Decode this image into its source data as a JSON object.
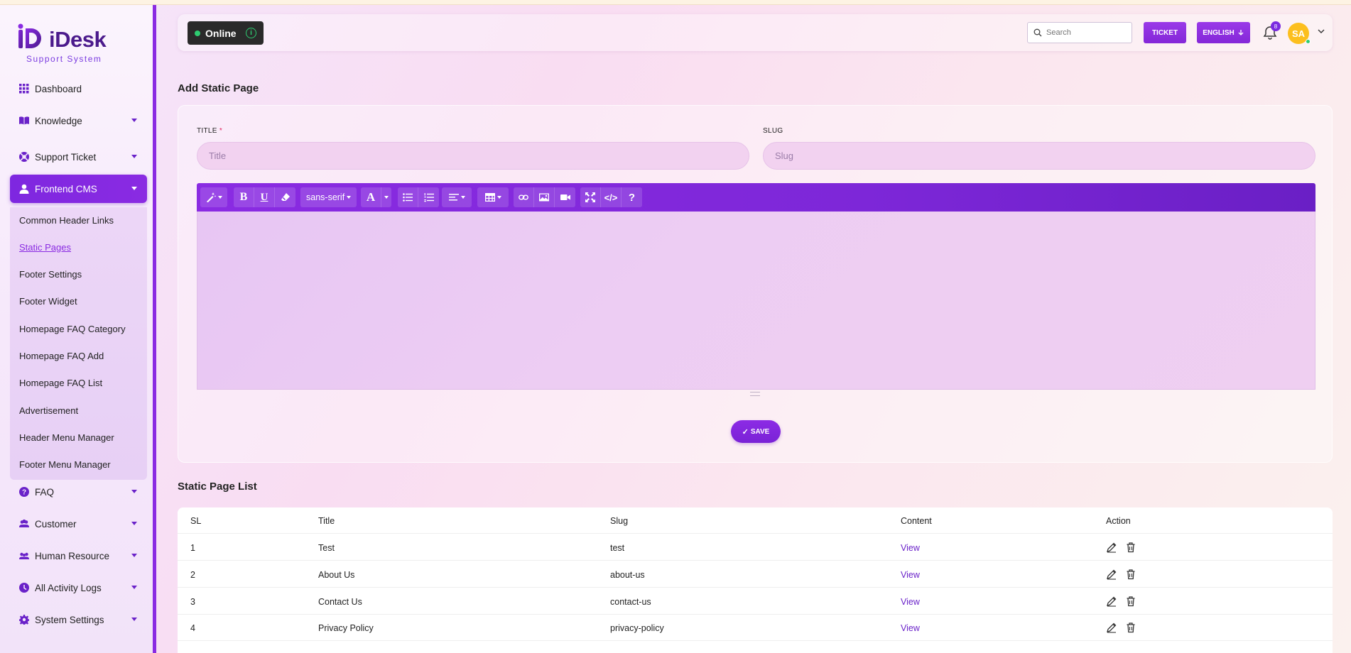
{
  "app": {
    "logo_text": "iDesk",
    "logo_sub": "Support System"
  },
  "sidebar": {
    "items": [
      {
        "label": "Dashboard",
        "icon": "grid-icon"
      },
      {
        "label": "Knowledge",
        "icon": "book-icon"
      },
      {
        "label": "Support Ticket",
        "icon": "life-ring-icon"
      },
      {
        "label": "Frontend CMS",
        "icon": "user-icon"
      },
      {
        "label": "FAQ",
        "icon": "question-circle-icon"
      },
      {
        "label": "Customer",
        "icon": "users-icon"
      },
      {
        "label": "Human Resource",
        "icon": "people-icon"
      },
      {
        "label": "All Activity Logs",
        "icon": "clock-icon"
      },
      {
        "label": "System Settings",
        "icon": "gear-icon"
      }
    ],
    "submenu": [
      "Common Header Links",
      "Static Pages",
      "Footer Settings",
      "Footer Widget",
      "Homepage FAQ Category",
      "Homepage FAQ Add",
      "Homepage FAQ List",
      "Advertisement",
      "Header Menu Manager",
      "Footer Menu Manager"
    ]
  },
  "header": {
    "status": "Online",
    "search_placeholder": "Search",
    "ticket_label": "TICKET",
    "language_label": "ENGLISH",
    "notifications_count": "8",
    "avatar_initials": "SA"
  },
  "form": {
    "section_title": "Add Static Page",
    "title_label": "TITLE",
    "title_required": "*",
    "title_placeholder": "Title",
    "slug_label": "SLUG",
    "slug_placeholder": "Slug",
    "font_name": "sans-serif",
    "save_label": "SAVE"
  },
  "list": {
    "section_title": "Static Page List",
    "columns": [
      "SL",
      "Title",
      "Slug",
      "Content",
      "Action"
    ],
    "rows": [
      {
        "sl": "1",
        "title": "Test",
        "slug": "test",
        "content": "View"
      },
      {
        "sl": "2",
        "title": "About Us",
        "slug": "about-us",
        "content": "View"
      },
      {
        "sl": "3",
        "title": "Contact Us",
        "slug": "contact-us",
        "content": "View"
      },
      {
        "sl": "4",
        "title": "Privacy Policy",
        "slug": "privacy-policy",
        "content": "View"
      }
    ]
  }
}
